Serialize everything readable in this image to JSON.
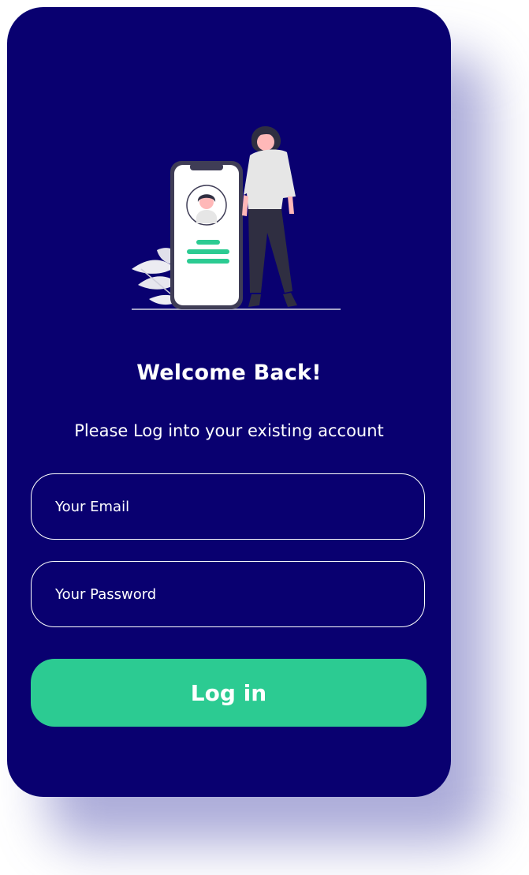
{
  "login_screen": {
    "heading": "Welcome Back!",
    "subheading": "Please Log into your existing account",
    "email_placeholder": "Your Email",
    "password_placeholder": "Your Password",
    "login_button": "Log in"
  },
  "colors": {
    "card_background": "#090070",
    "accent": "#2ccb92",
    "text": "#ffffff"
  },
  "illustration": {
    "icon": "phone-user-illustration"
  }
}
